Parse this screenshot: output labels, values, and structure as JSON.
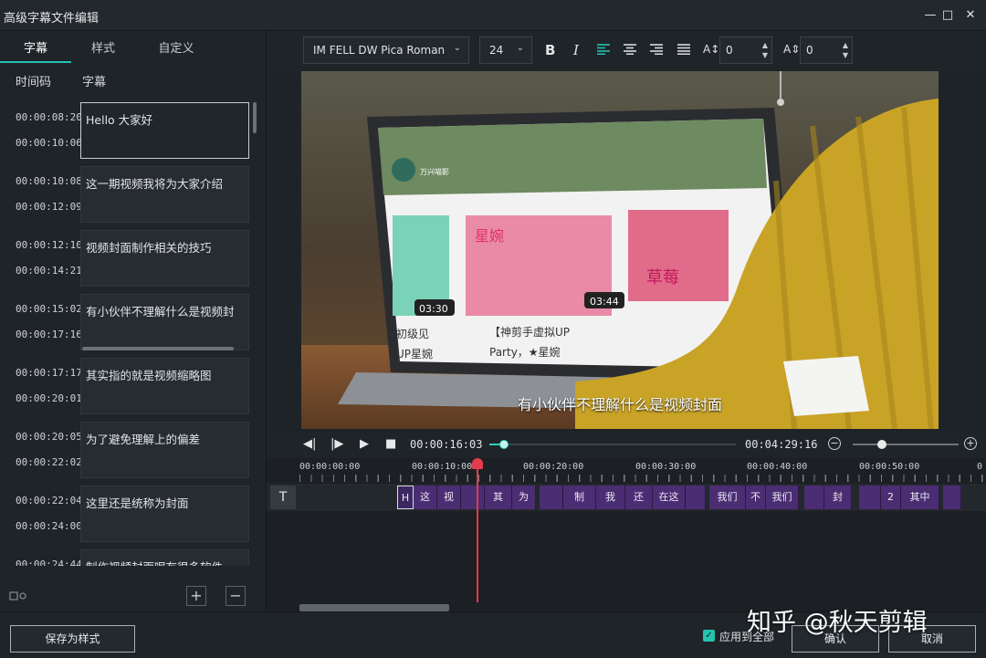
{
  "window": {
    "title": "高级字幕文件编辑",
    "controls": {
      "minimize": "—",
      "maximize": "□",
      "close": "✕"
    }
  },
  "left_panel": {
    "tabs": [
      {
        "label": "字幕",
        "active": true
      },
      {
        "label": "样式",
        "active": false
      },
      {
        "label": "自定义",
        "active": false
      }
    ],
    "columns": {
      "timecode": "时间码",
      "subtitle": "字幕"
    },
    "subtitles": [
      {
        "start": "00:00:08:20",
        "end": "00:00:10:06",
        "text": "Hello 大家好",
        "selected": true
      },
      {
        "start": "00:00:10:08",
        "end": "00:00:12:09",
        "text": "这一期视频我将为大家介绍",
        "selected": false
      },
      {
        "start": "00:00:12:10",
        "end": "00:00:14:21",
        "text": "视频封面制作相关的技巧",
        "selected": false
      },
      {
        "start": "00:00:15:02",
        "end": "00:00:17:16",
        "text": "有小伙伴不理解什么是视频封",
        "selected": false
      },
      {
        "start": "00:00:17:17",
        "end": "00:00:20:01",
        "text": "其实指的就是视频缩略图",
        "selected": false
      },
      {
        "start": "00:00:20:05",
        "end": "00:00:22:02",
        "text": "为了避免理解上的偏差",
        "selected": false
      },
      {
        "start": "00:00:22:04",
        "end": "00:00:24:00",
        "text": "这里还是统称为封面",
        "selected": false
      },
      {
        "start": "00:00:24:44",
        "end": "",
        "text": "制作视频封面呢有很多软件",
        "selected": false
      }
    ],
    "add_symbol": "+",
    "remove_symbol": "−"
  },
  "toolbar": {
    "font_family": "IM FELL DW Pica Roman",
    "font_size": "24",
    "bold": "B",
    "italic": "I",
    "char_spacing": "0",
    "line_spacing": "0"
  },
  "preview": {
    "subtitle_overlay": "有小伙伴不理解什么是视频封面",
    "screen_texts": [
      "万兴喵影",
      "03:30",
      "03:44",
      "初级见",
      "【神剪手虚拟UP",
      "UP星婉",
      "Party，★星婉",
      "星婉",
      "草莓"
    ]
  },
  "transport": {
    "current_time": "00:00:16:03",
    "total_time": "00:04:29:16",
    "seek_fraction": 0.06,
    "zoom_fraction": 0.28
  },
  "timeline": {
    "ruler_labels": [
      "00:00:00:00",
      "00:00:10:00",
      "00:00:20:00",
      "00:00:30:00",
      "00:00:40:00",
      "00:00:50:00",
      "0"
    ],
    "track_icon": "T",
    "clips": [
      "H",
      "这",
      "视",
      "",
      "其",
      "为",
      "",
      "制",
      "我",
      "还",
      "在这",
      "",
      "我们",
      "不",
      "我们",
      "",
      "封",
      "",
      "2",
      "其中",
      ""
    ]
  },
  "footer": {
    "save_style": "保存为样式",
    "apply_all": "应用到全部",
    "apply_all_checked": true,
    "confirm": "确认",
    "cancel": "取消"
  },
  "watermark": "知乎 @秋天剪辑",
  "colors": {
    "accent": "#25c2b0",
    "clip": "#4a2d72",
    "playhead": "#e23b4a",
    "background": "#1e2328"
  }
}
